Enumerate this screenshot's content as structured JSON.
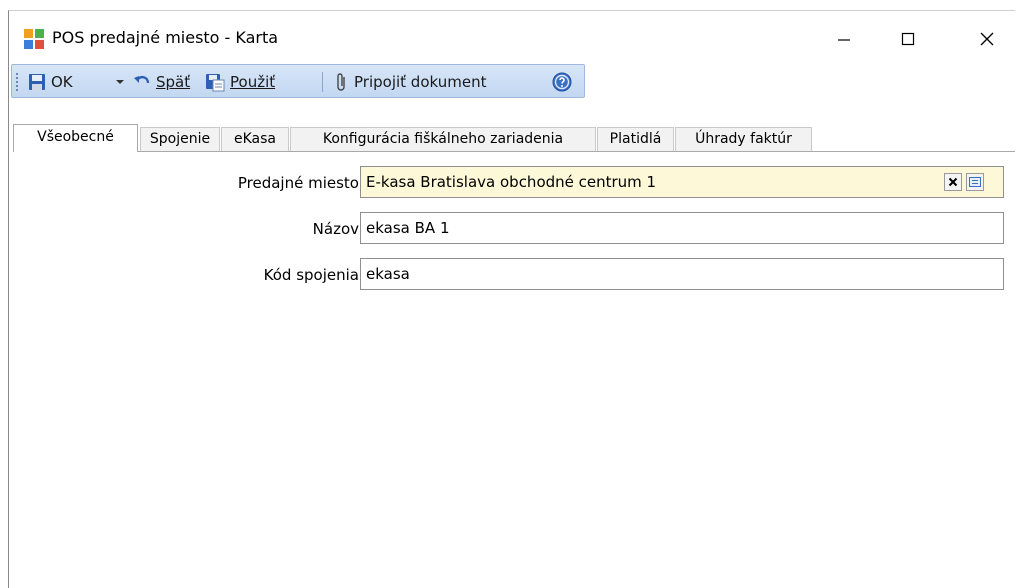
{
  "window": {
    "title": "POS predajné miesto - Karta",
    "icons": {
      "app": "app-grid-icon",
      "minimize": "minimize-icon",
      "maximize": "maximize-icon",
      "close": "close-icon"
    }
  },
  "toolbar": {
    "ok_label": "OK",
    "back_label": "Späť",
    "apply_label": "Použiť",
    "attach_label": "Pripojiť dokument",
    "icons": [
      "save-icon",
      "chevron-down-icon",
      "undo-icon",
      "apply-icon",
      "paperclip-icon",
      "help-icon"
    ]
  },
  "tabs": [
    {
      "label": "Všeobecné",
      "active": true
    },
    {
      "label": "Spojenie",
      "active": false
    },
    {
      "label": "eKasa",
      "active": false
    },
    {
      "label": "Konfigurácia fiškálneho zariadenia",
      "active": false
    },
    {
      "label": "Platidlá",
      "active": false
    },
    {
      "label": "Úhrady faktúr",
      "active": false
    }
  ],
  "form": {
    "predajne_miesto": {
      "label": "Predajné miesto",
      "value": "E-kasa Bratislava obchodné centrum 1"
    },
    "nazov": {
      "label": "Názov",
      "value": "ekasa BA 1"
    },
    "kod_spojenia": {
      "label": "Kód spojenia",
      "value": "ekasa"
    }
  },
  "colors": {
    "toolbar_bg": "#c9dcf3",
    "lookup_bg": "#fdf9d8",
    "border": "#8f8f8f"
  }
}
